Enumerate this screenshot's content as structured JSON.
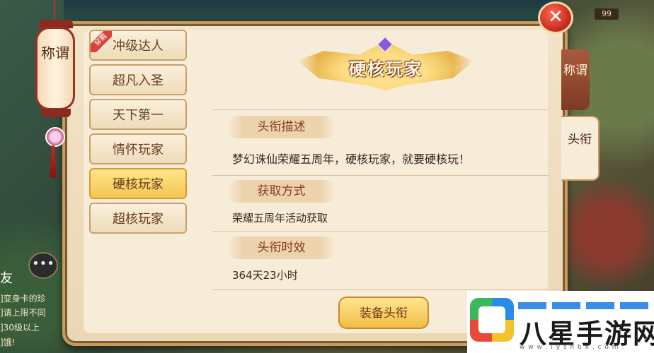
{
  "top_counter": "99",
  "lantern": {
    "label": "称谓"
  },
  "close_icon": "✕",
  "titles": [
    {
      "label": "冲级达人",
      "equipped_badge": "穿戴"
    },
    {
      "label": "超凡入圣"
    },
    {
      "label": "天下第一"
    },
    {
      "label": "情怀玩家"
    },
    {
      "label": "硬核玩家"
    },
    {
      "label": "超核玩家"
    }
  ],
  "detail": {
    "title": "硬核玩家",
    "sections": [
      {
        "label": "头衔描述",
        "text": "梦幻诛仙荣耀五周年，硬核玩家，就要硬核玩！"
      },
      {
        "label": "获取方式",
        "text": "荣耀五周年活动获取"
      },
      {
        "label": "头衔时效",
        "text": "364天23小时"
      }
    ],
    "equip_button": "装备头衔"
  },
  "side_tabs": [
    {
      "label": "称谓"
    },
    {
      "label": "头衔"
    }
  ],
  "left_chat": {
    "friend_label": "友",
    "lines": [
      "]变身卡的珍",
      "]请上限不同",
      "]30级以上",
      "]饿!"
    ]
  },
  "watermark": {
    "brand": "八星手游网",
    "url": "w w w . l y s h b x . c o m"
  }
}
